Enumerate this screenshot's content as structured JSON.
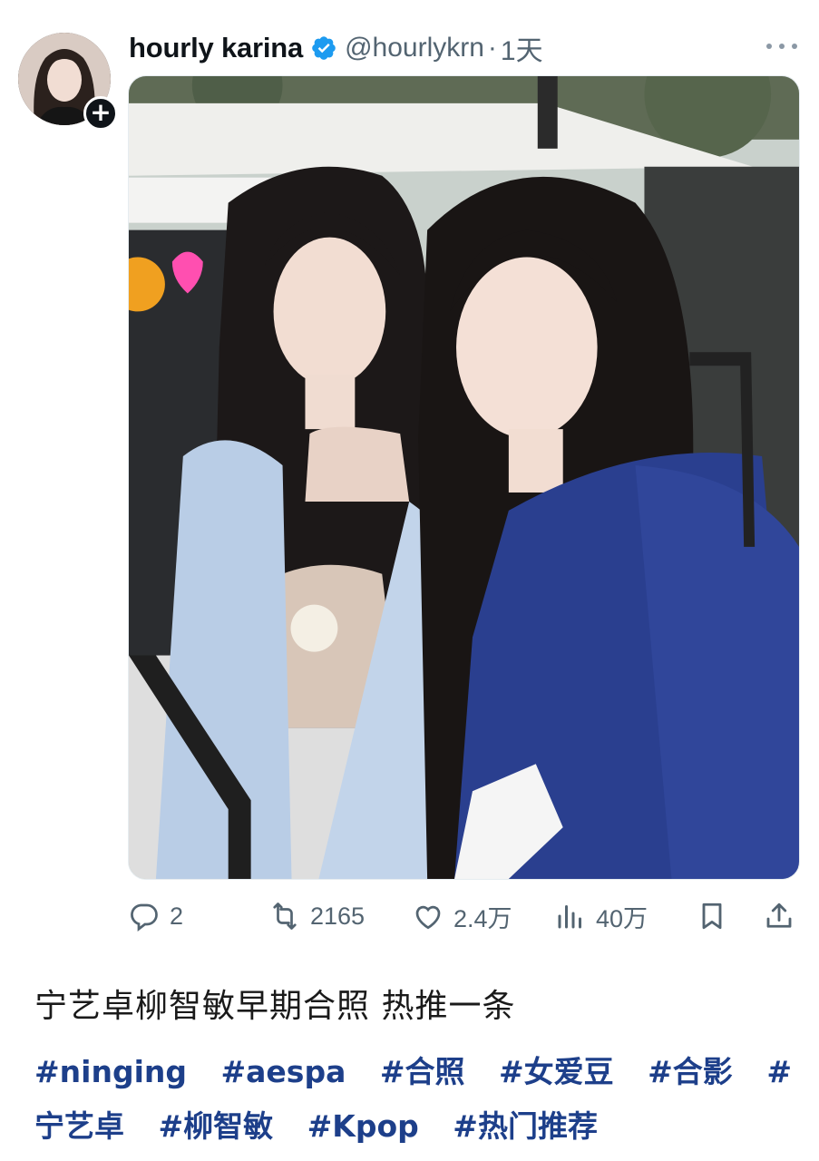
{
  "post": {
    "display_name": "hourly karina",
    "handle": "@hourlykrn",
    "separator": "·",
    "time": "1天",
    "verified": true
  },
  "actions": {
    "reply_count": "2",
    "retweet_count": "2165",
    "like_count": "2.4万",
    "views_count": "40万"
  },
  "caption": {
    "text": "宁艺卓柳智敏早期合照 热推一条",
    "tags": [
      "#ninging",
      "#aespa",
      "#合照",
      "#女爱豆",
      "#合影",
      "#宁艺卓",
      "#柳智敏",
      "#Kpop",
      "#热门推荐"
    ]
  },
  "colors": {
    "verified": "#1d9bf0",
    "muted_text": "#536471",
    "hashtag": "#1d3f8a",
    "blazer_navy": "#2a3f8f"
  },
  "icons": {
    "avatar": "avatar",
    "follow": "plus-icon",
    "verified": "verified-badge-icon",
    "more": "more-dots-icon",
    "reply": "reply-icon",
    "retweet": "retweet-icon",
    "like": "heart-icon",
    "views": "views-chart-icon",
    "bookmark": "bookmark-icon",
    "share": "share-icon"
  }
}
